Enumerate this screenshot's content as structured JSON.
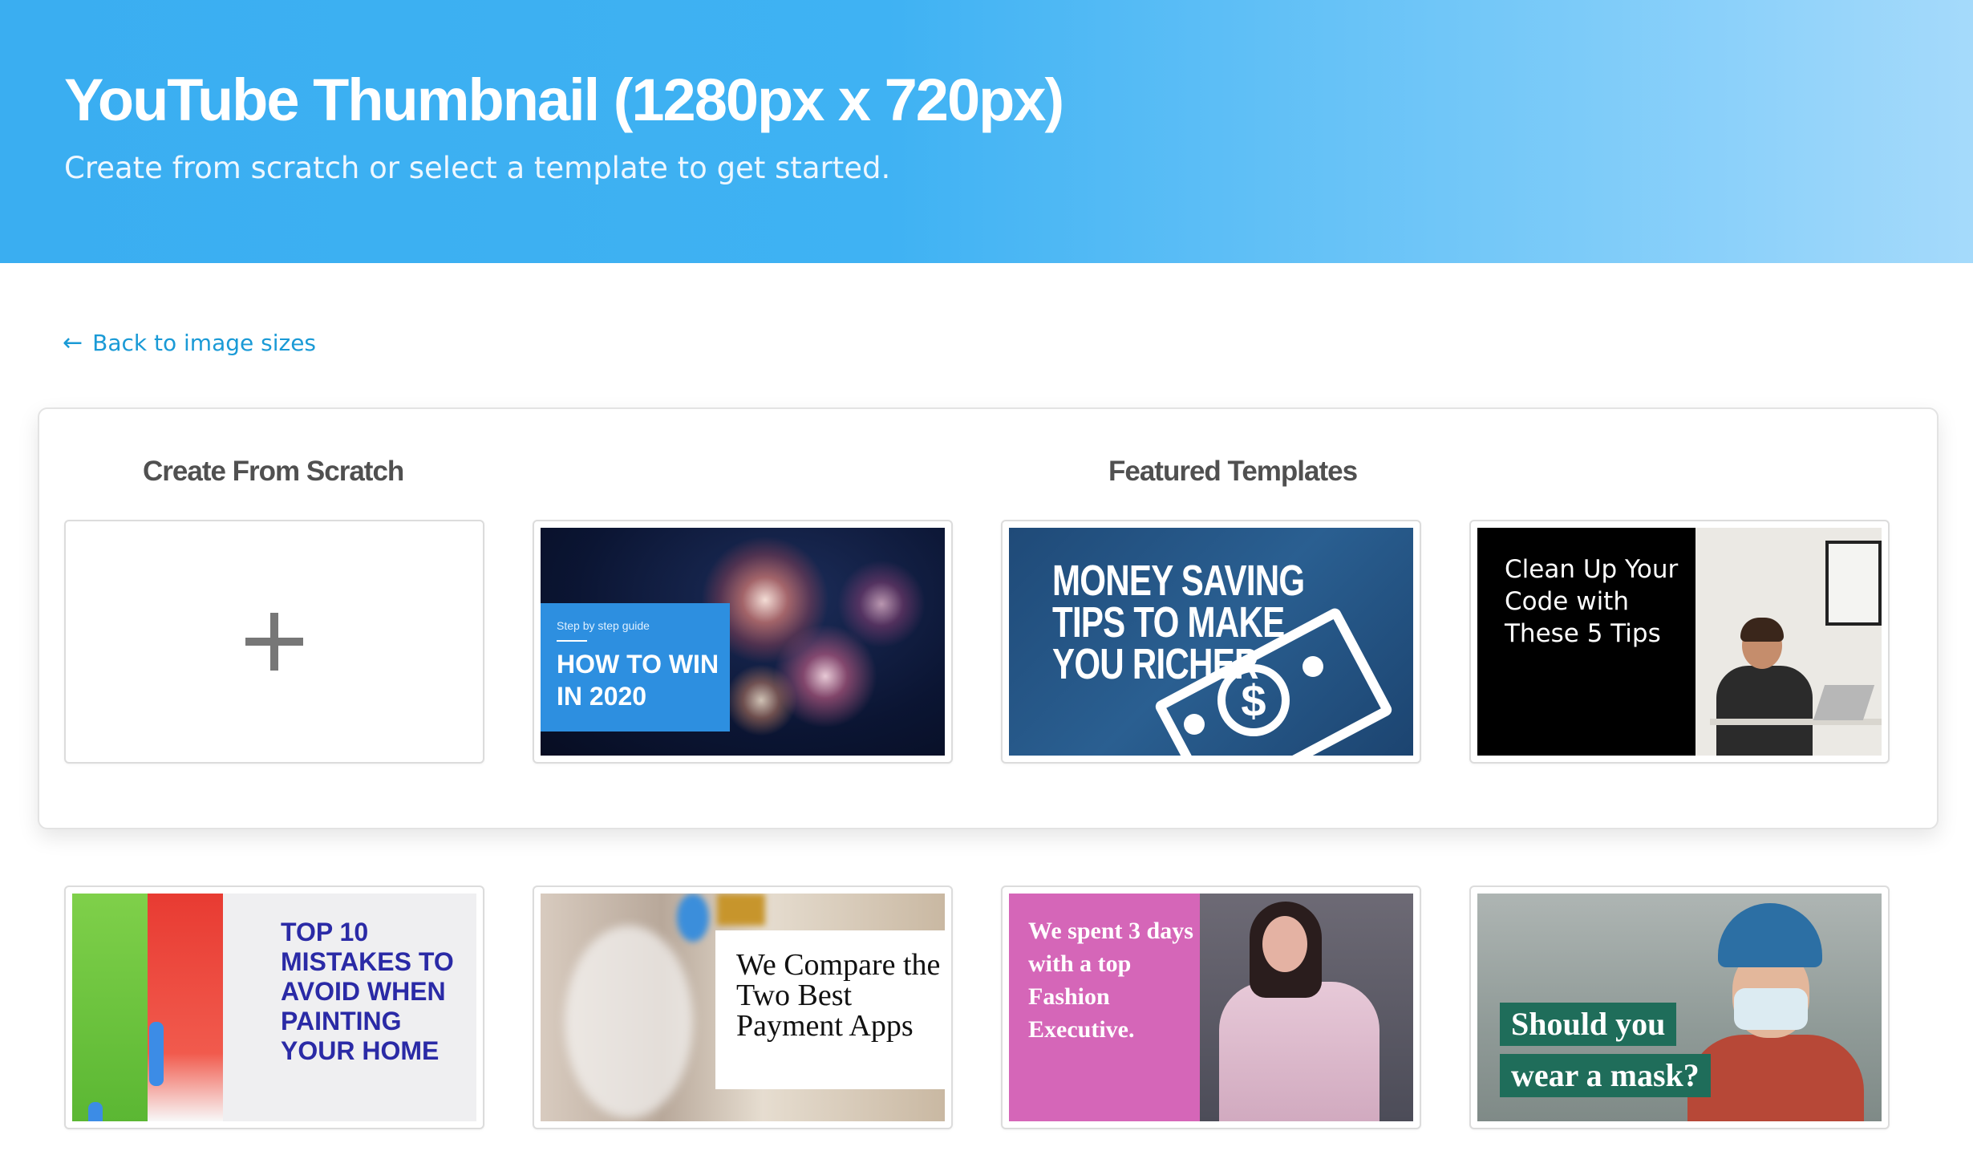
{
  "header": {
    "title": "YouTube Thumbnail (1280px x 720px)",
    "subtitle": "Create from scratch or select a template to get started."
  },
  "back_link": {
    "arrow": "←",
    "label": "Back to image sizes"
  },
  "sections": {
    "scratch_title": "Create From Scratch",
    "featured_title": "Featured Templates"
  },
  "scratch_card": {
    "icon": "plus-icon"
  },
  "templates": [
    {
      "name": "fireworks",
      "small": "Step by step guide",
      "headline": "HOW TO WIN IN 2020"
    },
    {
      "name": "money",
      "headline": "MONEY SAVING TIPS TO MAKE YOU RICHER",
      "symbol": "$"
    },
    {
      "name": "code",
      "headline": "Clean Up Your Code with These 5 Tips"
    },
    {
      "name": "paint",
      "headline": "TOP 10 MISTAKES TO AVOID WHEN PAINTING YOUR HOME"
    },
    {
      "name": "payment",
      "headline": "We Compare the Two Best Payment Apps"
    },
    {
      "name": "fashion",
      "headline": "We spent 3 days with a top Fashion Executive."
    },
    {
      "name": "mask",
      "line1": "Should you",
      "line2": "wear a mask?"
    }
  ],
  "colors": {
    "hero_gradient_start": "#3aaef1",
    "hero_gradient_end": "#a5dafb",
    "link": "#1a9ad6"
  }
}
